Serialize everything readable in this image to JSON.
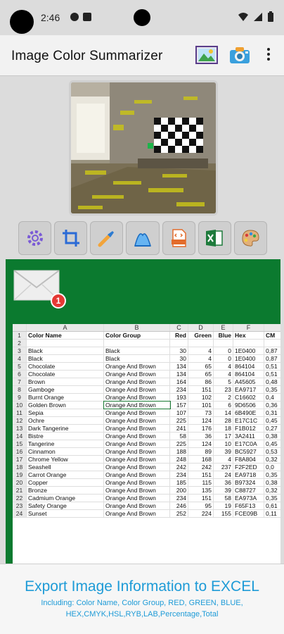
{
  "status_bar": {
    "time": "2:46"
  },
  "app": {
    "title": "Image Color Summarizer"
  },
  "icons": {
    "gallery": "image-gallery-icon",
    "camera": "camera-icon",
    "more": "more-vert-icon",
    "settings": "gear-icon",
    "crop": "crop-icon",
    "picker": "color-picker-icon",
    "histogram": "histogram-icon",
    "html": "html-file-icon",
    "excel": "excel-file-icon",
    "palette": "palette-icon",
    "mail": "mail-icon"
  },
  "mail_badge": "1",
  "sheet": {
    "col_letters": [
      "A",
      "B",
      "C",
      "D",
      "E",
      "F"
    ],
    "headers": [
      "Color Name",
      "Color Group",
      "Red",
      "Green",
      "Blue",
      "Hex",
      "CM"
    ],
    "rows": [
      [
        "3",
        "Black",
        "Black",
        "30",
        "4",
        "0",
        "1E0400",
        "0,87"
      ],
      [
        "4",
        "Black",
        "Black",
        "30",
        "4",
        "0",
        "1E0400",
        "0,87"
      ],
      [
        "5",
        "Chocolate",
        "Orange And Brown",
        "134",
        "65",
        "4",
        "864104",
        "0,51"
      ],
      [
        "6",
        "Chocolate",
        "Orange And Brown",
        "134",
        "65",
        "4",
        "864104",
        "0,51"
      ],
      [
        "7",
        "Brown",
        "Orange And Brown",
        "164",
        "86",
        "5",
        "A45605",
        "0,48"
      ],
      [
        "8",
        "Gamboge",
        "Orange And Brown",
        "234",
        "151",
        "23",
        "EA9717",
        "0,35"
      ],
      [
        "9",
        "Burnt Orange",
        "Orange And Brown",
        "193",
        "102",
        "2",
        "C16602",
        "0,4"
      ],
      [
        "10",
        "Golden Brown",
        "Orange And Brown",
        "157",
        "101",
        "6",
        "9D6506",
        "0,36"
      ],
      [
        "11",
        "Sepia",
        "Orange And Brown",
        "107",
        "73",
        "14",
        "6B490E",
        "0,31"
      ],
      [
        "12",
        "Ochre",
        "Orange And Brown",
        "225",
        "124",
        "28",
        "E17C1C",
        "0,45"
      ],
      [
        "13",
        "Dark Tangerine",
        "Orange And Brown",
        "241",
        "176",
        "18",
        "F1B012",
        "0,27"
      ],
      [
        "14",
        "Bistre",
        "Orange And Brown",
        "58",
        "36",
        "17",
        "3A2411",
        "0,38"
      ],
      [
        "15",
        "Tangerine",
        "Orange And Brown",
        "225",
        "124",
        "10",
        "E17C0A",
        "0,45"
      ],
      [
        "16",
        "Cinnamon",
        "Orange And Brown",
        "188",
        "89",
        "39",
        "BC5927",
        "0,53"
      ],
      [
        "17",
        "Chrome Yellow",
        "Orange And Brown",
        "248",
        "168",
        "4",
        "F8A804",
        "0,32"
      ],
      [
        "18",
        "Seashell",
        "Orange And Brown",
        "242",
        "242",
        "237",
        "F2F2ED",
        "0,0"
      ],
      [
        "19",
        "Carrot Orange",
        "Orange And Brown",
        "234",
        "151",
        "24",
        "EA9718",
        "0,35"
      ],
      [
        "20",
        "Copper",
        "Orange And Brown",
        "185",
        "115",
        "36",
        "B97324",
        "0,38"
      ],
      [
        "21",
        "Bronze",
        "Orange And Brown",
        "200",
        "135",
        "39",
        "C88727",
        "0,32"
      ],
      [
        "22",
        "Cadmium Orange",
        "Orange And Brown",
        "234",
        "151",
        "58",
        "EA973A",
        "0,35"
      ],
      [
        "23",
        "Safety Orange",
        "Orange And Brown",
        "246",
        "95",
        "19",
        "F65F13",
        "0,61"
      ],
      [
        "24",
        "Sunset",
        "Orange And Brown",
        "252",
        "224",
        "155",
        "FCE09B",
        "0,11"
      ]
    ]
  },
  "banner": {
    "title": "Export Image Information to EXCEL",
    "subtitle": "Including: Color Name, Color Group, RED, GREEN, BLUE, HEX,CMYK,HSL,RYB,LAB,Percentage,Total"
  }
}
